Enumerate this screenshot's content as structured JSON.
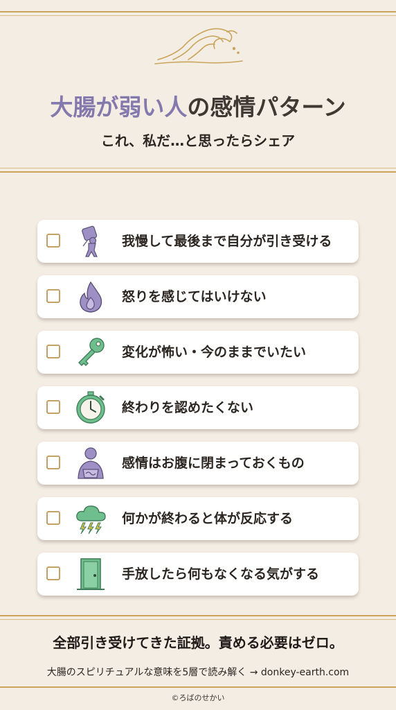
{
  "header": {
    "title_accent": "大腸が弱い人",
    "title_rest": "の感情パターン",
    "subtitle": "これ、私だ…と思ったらシェア"
  },
  "checklist": [
    {
      "label": "我慢して最後まで自分が引き受ける",
      "icon": "person-carrying-heavy-load-icon",
      "checked": false
    },
    {
      "label": "怒りを感じてはいけない",
      "icon": "flame-icon",
      "checked": false
    },
    {
      "label": "変化が怖い・今のままでいたい",
      "icon": "key-icon",
      "checked": false
    },
    {
      "label": "終わりを認めたくない",
      "icon": "stopwatch-icon",
      "checked": false
    },
    {
      "label": "感情はお腹に閉まっておくもの",
      "icon": "person-holding-belly-icon",
      "checked": false
    },
    {
      "label": "何かが終わると体が反応する",
      "icon": "thunder-cloud-icon",
      "checked": false
    },
    {
      "label": "手放したら何もなくなる気がする",
      "icon": "door-icon",
      "checked": false
    }
  ],
  "footer": {
    "main": "全部引き受けてきた証拠。責める必要はゼロ。",
    "sub": "大腸のスピリチュアルな意味を5層で読み解く → donkey-earth.com",
    "credit": "©ろばのせかい"
  },
  "colors": {
    "background": "#f4ede3",
    "gold": "#c9a45a",
    "purple_accent": "#8479ad",
    "icon_purple": "#9e90c4",
    "icon_green": "#6fbf8e"
  }
}
